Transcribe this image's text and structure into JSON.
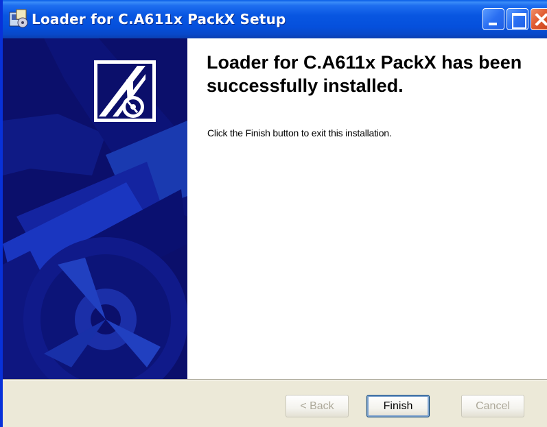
{
  "window": {
    "title": "Loader for C.A611x PackX Setup"
  },
  "titlebar_buttons": {
    "minimize_icon": "minimize-icon",
    "maximize_icon": "maximize-icon",
    "close_icon": "close-icon"
  },
  "content": {
    "heading": "Loader for C.A611x PackX has been successfully installed.",
    "message": "Click the Finish button to exit this installation."
  },
  "buttons": {
    "back": "< Back",
    "finish": "Finish",
    "cancel": "Cancel"
  },
  "colors": {
    "titlebar": "#0856e1",
    "banner": "#0b0f6b",
    "dialog_background": "#ece9d8",
    "close_button": "#e05a30"
  }
}
